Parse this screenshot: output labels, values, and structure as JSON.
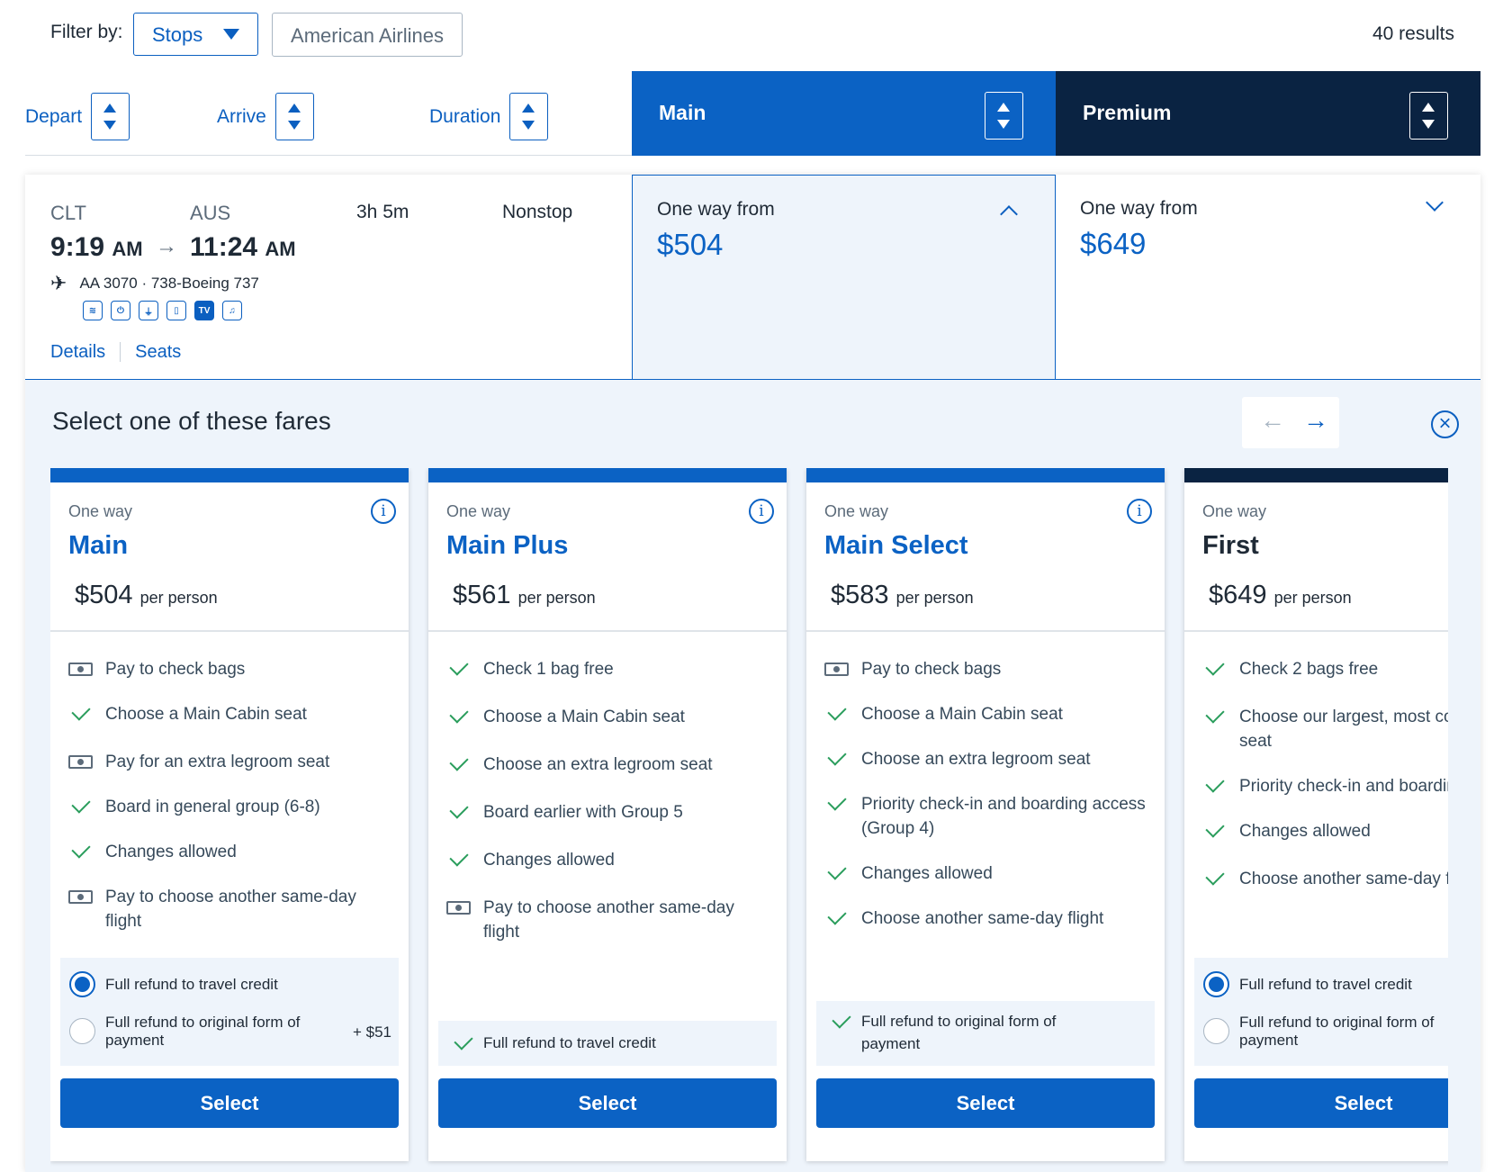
{
  "filter": {
    "label": "Filter by:",
    "stops_value": "Stops",
    "airline_chip": "American Airlines",
    "results": "40 results"
  },
  "sort": {
    "depart": "Depart",
    "arrive": "Arrive",
    "duration": "Duration"
  },
  "cabins": {
    "main": "Main",
    "premium": "Premium"
  },
  "flight": {
    "origin": "CLT",
    "destination": "AUS",
    "depart_time": "9:19",
    "depart_ampm": "AM",
    "arrive_time": "11:24",
    "arrive_ampm": "AM",
    "arrow": "→",
    "duration": "3h 5m",
    "stops": "Nonstop",
    "flight_number": "AA 3070 · 738-Boeing 737",
    "amenities": [
      "wifi-icon",
      "power-outlet-icon",
      "usb-icon",
      "phone-device-icon",
      "tv-icon",
      "music-icon"
    ],
    "details_link": "Details",
    "seats_link": "Seats",
    "main_one_way_from": "One way from",
    "main_price": "$504",
    "premium_one_way_from": "One way from",
    "premium_price": "$649"
  },
  "panel": {
    "title": "Select one of these fares",
    "prev": "←",
    "next": "→",
    "close": "×"
  },
  "fares": [
    {
      "one_way": "One way",
      "name": "Main",
      "price": "$504",
      "per_person": "per person",
      "features": [
        {
          "icon": "money",
          "text": "Pay to check bags"
        },
        {
          "icon": "check",
          "text": "Choose a Main Cabin seat"
        },
        {
          "icon": "money",
          "text": "Pay for an extra legroom seat"
        },
        {
          "icon": "check",
          "text": "Board in general group (6-8)"
        },
        {
          "icon": "check",
          "text": "Changes allowed"
        },
        {
          "icon": "money",
          "text": "Pay to choose another same-day flight"
        }
      ],
      "refund_options": [
        {
          "label": "Full refund to travel credit",
          "selected": true
        },
        {
          "label": "Full refund to original form of payment",
          "addon": "+ $51",
          "selected": false
        }
      ],
      "select": "Select"
    },
    {
      "one_way": "One way",
      "name": "Main Plus",
      "price": "$561",
      "per_person": "per person",
      "features": [
        {
          "icon": "check",
          "text": "Check 1 bag free"
        },
        {
          "icon": "check",
          "text": "Choose a Main Cabin seat"
        },
        {
          "icon": "check",
          "text": "Choose an extra legroom seat"
        },
        {
          "icon": "check",
          "text": "Board earlier with Group 5"
        },
        {
          "icon": "check",
          "text": "Changes allowed"
        },
        {
          "icon": "money",
          "text": "Pay to choose another same-day flight"
        }
      ],
      "refund_included": "Full refund to travel credit",
      "select": "Select"
    },
    {
      "one_way": "One way",
      "name": "Main Select",
      "price": "$583",
      "per_person": "per person",
      "features": [
        {
          "icon": "money",
          "text": "Pay to check bags"
        },
        {
          "icon": "check",
          "text": "Choose a Main Cabin seat"
        },
        {
          "icon": "check",
          "text": "Choose an extra legroom seat"
        },
        {
          "icon": "check",
          "text": "Priority check-in and boarding access (Group 4)"
        },
        {
          "icon": "check",
          "text": "Changes allowed"
        },
        {
          "icon": "check",
          "text": "Choose another same-day flight"
        }
      ],
      "refund_included": "Full refund to original form of payment",
      "select": "Select"
    },
    {
      "one_way": "One way",
      "name": "First",
      "price": "$649",
      "per_person": "per person",
      "features": [
        {
          "icon": "check",
          "text": "Check 2 bags free"
        },
        {
          "icon": "check",
          "text": "Choose our largest, most comfortable seat"
        },
        {
          "icon": "check",
          "text": "Priority check-in and boarding access"
        },
        {
          "icon": "check",
          "text": "Changes allowed"
        },
        {
          "icon": "check",
          "text": "Choose another same-day flight"
        }
      ],
      "refund_options": [
        {
          "label": "Full refund to travel credit",
          "selected": true
        },
        {
          "label": "Full refund to original form of payment",
          "selected": false
        }
      ],
      "select": "Select"
    }
  ]
}
